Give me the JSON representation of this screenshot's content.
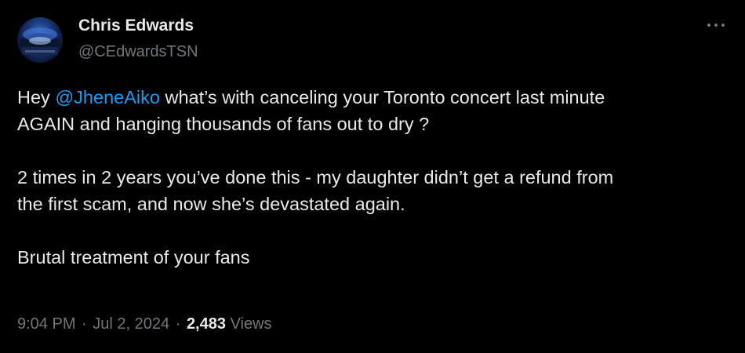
{
  "author": {
    "name": "Chris Edwards",
    "handle": "@CEdwardsTSN"
  },
  "tweet": {
    "line1_pre": "Hey ",
    "mention": "@JheneAiko",
    "line1_post": " what’s with canceling your Toronto concert last minute",
    "line2": "AGAIN and hanging thousands of fans out to dry ?",
    "para2_line1": "2 times in 2 years you’ve done this - my daughter didn’t get a refund from",
    "para2_line2": "the first scam, and now she’s devastated again.",
    "para3": "Brutal treatment of your fans"
  },
  "meta": {
    "time": "9:04 PM",
    "dot1": "·",
    "date": "Jul 2, 2024",
    "dot2": "·",
    "views_count": "2,483",
    "views_label": "Views"
  },
  "icons": {
    "more": "more-horizontal-icon"
  },
  "colors": {
    "background": "#000000",
    "text": "#e7e9ea",
    "secondary": "#71767b",
    "accent": "#1d9bf0"
  }
}
